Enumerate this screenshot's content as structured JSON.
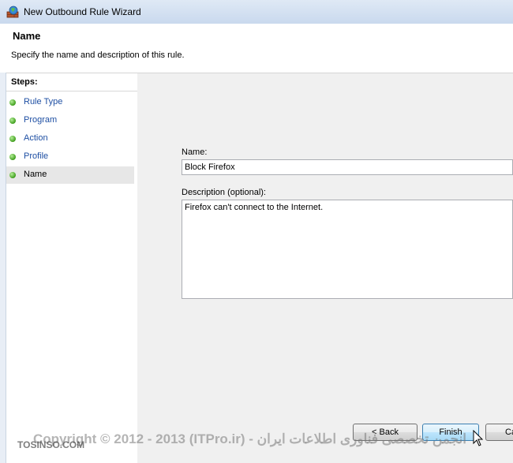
{
  "window": {
    "title": "New Outbound Rule Wizard"
  },
  "header": {
    "title": "Name",
    "subtitle": "Specify the name and description of this rule."
  },
  "steps": {
    "title": "Steps:",
    "items": [
      {
        "label": "Rule Type"
      },
      {
        "label": "Program"
      },
      {
        "label": "Action"
      },
      {
        "label": "Profile"
      },
      {
        "label": "Name"
      }
    ]
  },
  "form": {
    "name_label": "Name:",
    "name_value": "Block Firefox",
    "description_label": "Description (optional):",
    "description_value": "Firefox can't connect to the Internet."
  },
  "buttons": {
    "back": "< Back",
    "finish": "Finish",
    "cancel": "Cancel"
  },
  "watermark": {
    "text": "Copyright © 2012 - 2013 (ITPro.ir) - انجمن تخصصی فناوری اطلاعات ایران",
    "site": "TOSINSO.COM"
  },
  "icons": {
    "title": "firewall-globe-icon",
    "step": "green-dot-icon",
    "cursor": "mouse-pointer-icon"
  }
}
